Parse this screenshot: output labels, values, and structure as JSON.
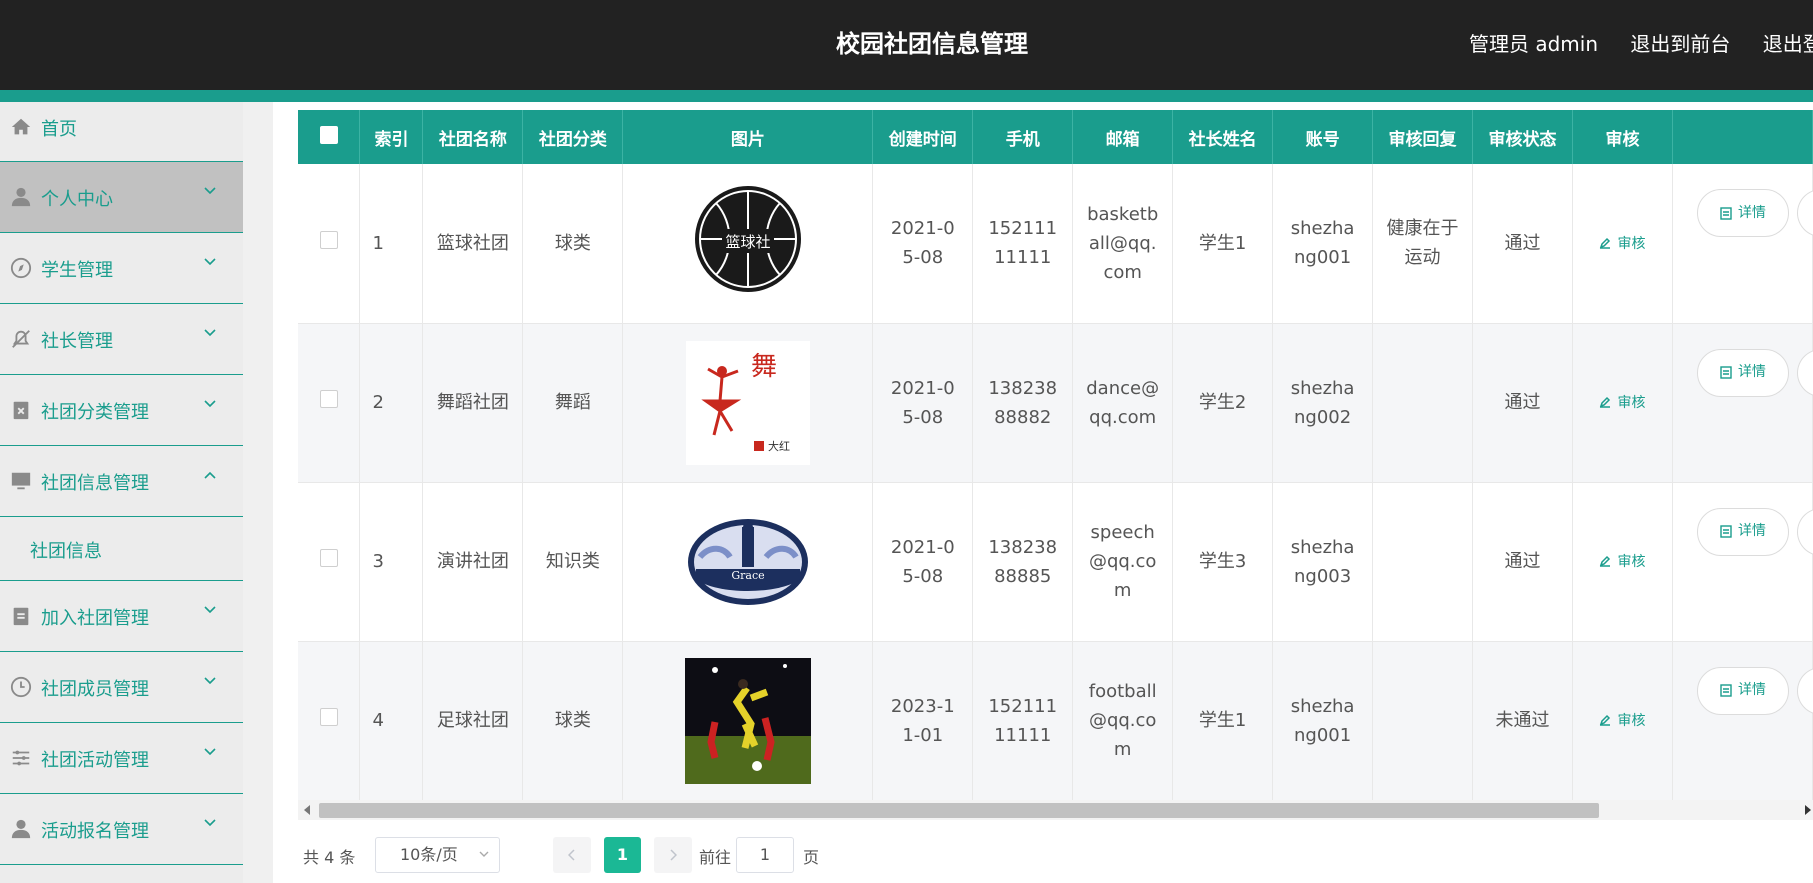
{
  "header": {
    "title": "校园社团信息管理",
    "admin_label": "管理员 admin",
    "exit_front": "退出到前台",
    "logout": "退出登录"
  },
  "sidebar": {
    "items": [
      {
        "label": "首页",
        "icon": "home-icon"
      },
      {
        "label": "个人中心",
        "icon": "user-icon",
        "active": true
      },
      {
        "label": "学生管理",
        "icon": "compass-icon"
      },
      {
        "label": "社长管理",
        "icon": "bell-off-icon"
      },
      {
        "label": "社团分类管理",
        "icon": "clipboard-x-icon"
      },
      {
        "label": "社团信息管理",
        "icon": "monitor-icon",
        "expanded": true
      },
      {
        "label": "加入社团管理",
        "icon": "clipboard-icon"
      },
      {
        "label": "社团成员管理",
        "icon": "clock-icon"
      },
      {
        "label": "社团活动管理",
        "icon": "sliders-icon"
      },
      {
        "label": "活动报名管理",
        "icon": "user-icon"
      }
    ],
    "sub_item": "社团信息"
  },
  "table": {
    "headers": [
      "索引",
      "社团名称",
      "社团分类",
      "图片",
      "创建时间",
      "手机",
      "邮箱",
      "社长姓名",
      "账号",
      "审核回复",
      "审核状态",
      "审核"
    ],
    "rows": [
      {
        "index": "1",
        "name": "篮球社团",
        "category": "球类",
        "image": "basketball-club-logo",
        "image_text": "篮球社",
        "created": "2021-05-08",
        "phone": "15211111111",
        "email": "basketball@qq.com",
        "leader": "学生1",
        "account": "shezhang001",
        "reply": "健康在于运动",
        "status": "通过",
        "audit": "审核"
      },
      {
        "index": "2",
        "name": "舞蹈社团",
        "category": "舞蹈",
        "image": "dance-club-logo",
        "image_text": "舞",
        "image_caption": "大红",
        "created": "2021-05-08",
        "phone": "13823888882",
        "email": "dance@qq.com",
        "leader": "学生2",
        "account": "shezhang002",
        "reply": "",
        "status": "通过",
        "audit": "审核"
      },
      {
        "index": "3",
        "name": "演讲社团",
        "category": "知识类",
        "image": "speech-club-logo",
        "image_text": "Grace",
        "created": "2021-05-08",
        "phone": "13823888885",
        "email": "speech@qq.com",
        "leader": "学生3",
        "account": "shezhang003",
        "reply": "",
        "status": "通过",
        "audit": "审核"
      },
      {
        "index": "4",
        "name": "足球社团",
        "category": "球类",
        "image": "football-photo",
        "created": "2023-11-01",
        "phone": "15211111111",
        "email": "football@qq.com",
        "leader": "学生1",
        "account": "shezhang001",
        "reply": "",
        "status": "未通过",
        "audit": "审核"
      }
    ],
    "detail_label": "详情"
  },
  "pagination": {
    "total": "共 4 条",
    "page_size": "10条/页",
    "current": "1",
    "goto_label": "前往",
    "goto_value": "1",
    "page_suffix": "页"
  },
  "colors": {
    "accent": "#1a9d8d",
    "header_bg": "#222222",
    "active_page": "#1bb895"
  }
}
